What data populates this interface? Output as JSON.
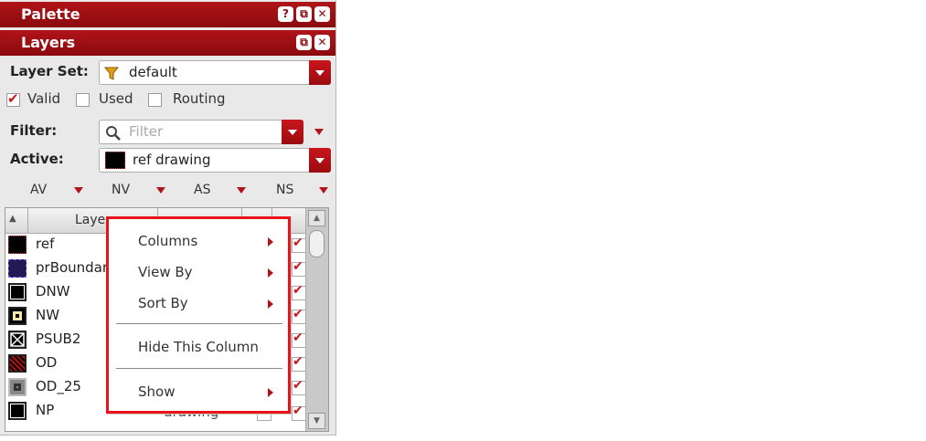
{
  "palette": {
    "title": "Palette",
    "help": "?",
    "float": "⧉",
    "close": "✕"
  },
  "layers": {
    "title": "Layers",
    "float": "⧉",
    "close": "✕"
  },
  "layer_set": {
    "label": "Layer Set:",
    "value": "default"
  },
  "checks": [
    {
      "label": "Valid",
      "checked": true
    },
    {
      "label": "Used",
      "checked": false
    },
    {
      "label": "Routing",
      "checked": false
    }
  ],
  "filter": {
    "label": "Filter:",
    "placeholder": "Filter"
  },
  "active": {
    "label": "Active:",
    "value": "ref drawing"
  },
  "columns": [
    "AV",
    "NV",
    "AS",
    "NS"
  ],
  "table": {
    "header": "Layer",
    "rows": [
      {
        "name": "ref",
        "purpose": ""
      },
      {
        "name": "prBoundary",
        "purpose": ""
      },
      {
        "name": "DNW",
        "purpose": ""
      },
      {
        "name": "NW",
        "purpose": ""
      },
      {
        "name": "PSUB2",
        "purpose": ""
      },
      {
        "name": "OD",
        "purpose": ""
      },
      {
        "name": "OD_25",
        "purpose": ""
      },
      {
        "name": "NP",
        "purpose": "drawing"
      }
    ]
  },
  "context_menu": {
    "items": [
      {
        "label": "Columns",
        "submenu": true
      },
      {
        "label": "View By",
        "submenu": true
      },
      {
        "label": "Sort By",
        "submenu": true
      },
      {
        "label": "Hide This Column",
        "submenu": false
      },
      {
        "label": "Show",
        "submenu": true
      }
    ]
  },
  "colors": {
    "title_red": "#9e0f13",
    "menu_border": "#e8141a",
    "accent_red": "#c8161c"
  }
}
